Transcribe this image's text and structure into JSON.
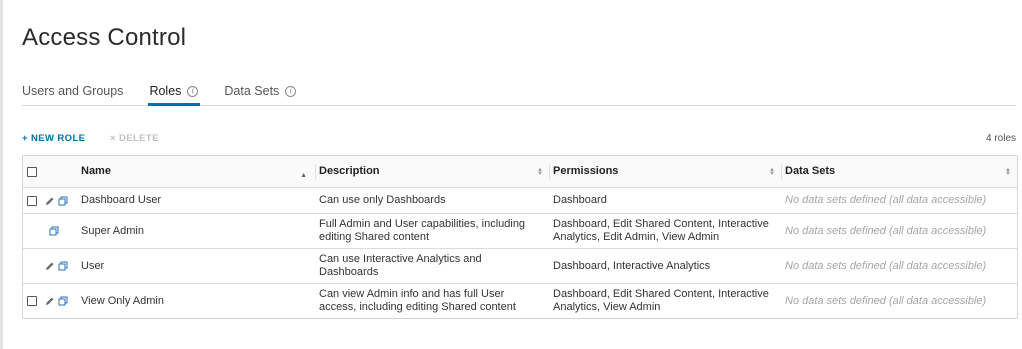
{
  "page": {
    "title": "Access Control"
  },
  "tabs": [
    {
      "label": "Users and Groups",
      "active": false,
      "info": false
    },
    {
      "label": "Roles",
      "active": true,
      "info": true
    },
    {
      "label": "Data Sets",
      "active": false,
      "info": true
    }
  ],
  "toolbar": {
    "new_label": "+ NEW ROLE",
    "delete_label": "× DELETE",
    "count": "4 roles"
  },
  "table": {
    "columns": [
      "Name",
      "Description",
      "Permissions",
      "Data Sets"
    ],
    "rows": [
      {
        "name": "Dashboard User",
        "description": "Can use only Dashboards",
        "permissions": "Dashboard",
        "data_sets": "No data sets defined (all data accessible)"
      },
      {
        "name": "Super Admin",
        "description": "Full Admin and User capabilities, including editing Shared content",
        "permissions": "Dashboard, Edit Shared Content, Interactive Analytics, Edit Admin, View Admin",
        "data_sets": "No data sets defined (all data accessible)"
      },
      {
        "name": "User",
        "description": "Can use Interactive Analytics and Dashboards",
        "permissions": "Dashboard, Interactive Analytics",
        "data_sets": "No data sets defined (all data accessible)"
      },
      {
        "name": "View Only Admin",
        "description": "Can view Admin info and has full User access, including editing Shared content",
        "permissions": "Dashboard, Edit Shared Content, Interactive Analytics, View Admin",
        "data_sets": "No data sets defined (all data accessible)"
      }
    ]
  },
  "colors": {
    "accent": "#0072a3",
    "disabled": "#c2c2c2",
    "placeholder": "#a5a5a5"
  }
}
